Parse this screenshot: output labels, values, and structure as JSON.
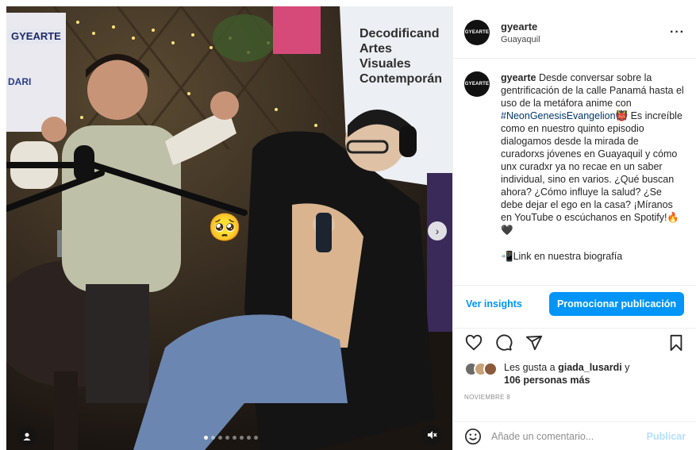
{
  "post": {
    "username": "gyearte",
    "location": "Guayaquil",
    "avatar_label": "GYEARTE",
    "more_icon": "more-horizontal-icon"
  },
  "media": {
    "banner_lines": [
      "Decodificand",
      "Artes",
      "Visuales",
      "Contemporán"
    ],
    "logo_left": "GYEARTE",
    "logo_left2": "DARI",
    "sticker": "🥺",
    "carousel_count": 8,
    "carousel_active": 1
  },
  "caption": {
    "username": "gyearte",
    "text_before": " Desde conversar sobre la gentrificación de la calle Panamá hasta el uso de la metáfora anime con ",
    "hashtag": "#NeonGenesisEvangelion",
    "text_after": "👹 Es increíble como en nuestro quinto episodio dialogamos desde la mirada de curadorxs jóvenes en Guayaquil y cómo unx curadxr ya no recae en un saber individual, sino en varios. ¿Qué buscan ahora? ¿Cómo influye la salud? ¿Se debe dejar el ego en la casa? ¡Míranos en YouTube o escúchanos en Spotify!🔥🖤",
    "link_line": "📲Link en nuestra biografía"
  },
  "actions": {
    "insights_label": "Ver insights",
    "promote_label": "Promocionar publicación"
  },
  "likes": {
    "prefix": "Les gusta a ",
    "user": "giada_lusardi",
    "middle": " y",
    "others": "106 personas más",
    "face_colors": [
      "#6b6b6b",
      "#c9a27a",
      "#8a5a3a"
    ]
  },
  "date": "NOVIEMBRE 8",
  "comment": {
    "placeholder": "Añade un comentario...",
    "publish_label": "Publicar"
  },
  "colors": {
    "accent": "#0095f6",
    "hashtag": "#00376b",
    "muted": "#8e8e8e"
  }
}
